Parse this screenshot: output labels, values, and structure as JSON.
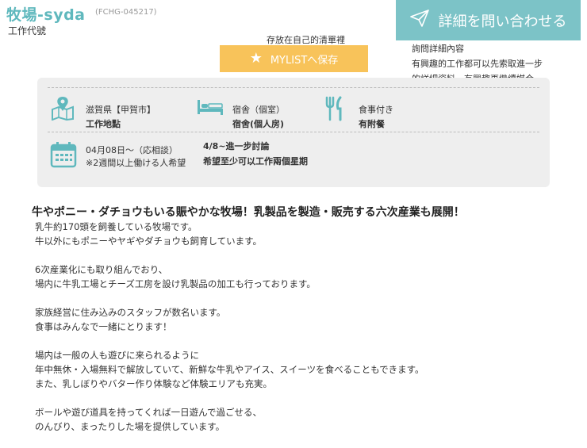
{
  "header": {
    "title": "牧場-syda",
    "code": "(FCHG-045217)",
    "subtitle": "工作代號"
  },
  "mylist": {
    "note": "存放在自己的清單裡",
    "button_label": "MYLISTへ保存",
    "icon": "star-icon"
  },
  "inquiry": {
    "button_label": "詳細を問い合わせる",
    "icon": "paper-plane-icon",
    "note_lines": [
      "詢問詳細內容",
      "有興趣的工作都可以先索取進一步",
      "的詳細資料，有興趣再繼續媒合。"
    ]
  },
  "info": {
    "location": {
      "icon": "map-icon",
      "label": "滋賀県【甲賀市】",
      "value": "工作地點"
    },
    "housing": {
      "icon": "bed-icon",
      "label": "宿舎（個室）",
      "value": "宿舍(個人房)"
    },
    "meals": {
      "icon": "fork-knife-icon",
      "label": "食事付き",
      "value": "有附餐"
    },
    "period": {
      "icon": "calendar-icon",
      "label": "04月08日～（応相談）",
      "label2": "※2週間以上働ける人希望",
      "value": "4/8~進一步討論",
      "value2": "希望至少可以工作兩個星期"
    }
  },
  "description": {
    "headline": "牛やポニー・ダチョウもいる賑やかな牧場！乳製品を製造・販売する六次産業も展開！",
    "paragraphs": [
      "乳牛約170頭を飼養している牧場です。\n牛以外にもポニーやヤギやダチョウも飼育しています。",
      "6次産業化にも取り組んでおり、\n場内に牛乳工場とチーズ工房を設け乳製品の加工も行っております。",
      "家族経営に住み込みのスタッフが数名います。\n食事はみんなで一緒にとります！",
      "場内は一般の人も遊びに来られるように\n年中無休・入場無料で解放していて、新鮮な牛乳やアイス、スイーツを食べることもできます。\nまた、乳しぼりやバター作り体験など体験エリアも充実。",
      "ボールや遊び道具を持ってくれば一日遊んで過ごせる、\nのんびり、まったりした場を提供しています。"
    ]
  },
  "colors": {
    "accent": "#7cc3c7",
    "title": "#5fb8bd",
    "mylist": "#f8c35a",
    "box": "#eeeeee"
  }
}
